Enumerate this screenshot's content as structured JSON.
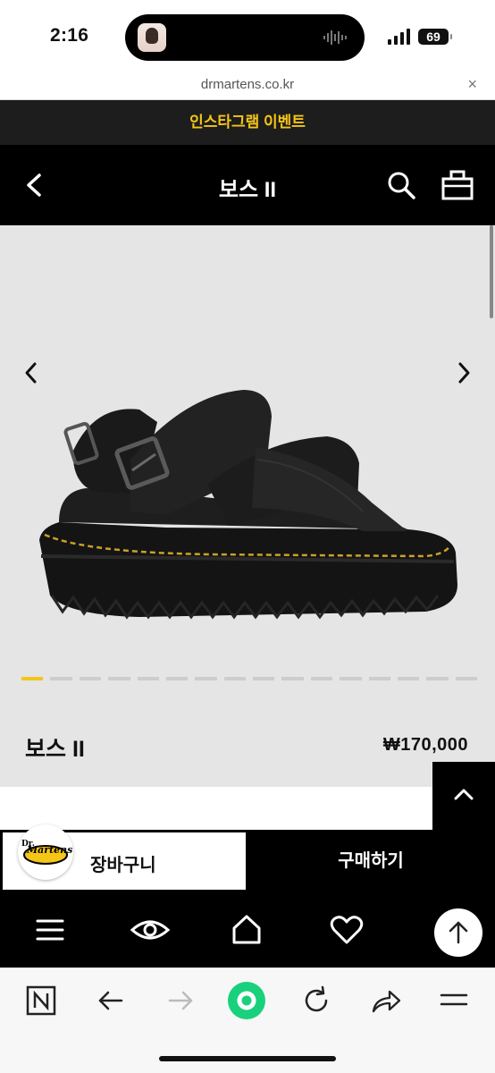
{
  "status_bar": {
    "time": "2:16",
    "battery": "69"
  },
  "browser": {
    "url": "drmartens.co.kr",
    "close_glyph": "×"
  },
  "promo": {
    "text": "인스타그램 이벤트"
  },
  "header": {
    "title": "보스 II"
  },
  "gallery": {
    "slide_count": 16,
    "active_index": 0
  },
  "product": {
    "name": "보스 II",
    "price": "₩170,000"
  },
  "actions": {
    "cart_label": "장바구니",
    "buy_label": "구매하기"
  },
  "logo": {
    "text_line1": "Dr.",
    "text_line2": "Martens"
  },
  "site_nav": {
    "items": [
      "menu-icon",
      "eye-icon",
      "home-icon",
      "heart-icon"
    ]
  },
  "toolbar": {
    "items": [
      "naver-icon",
      "back-icon",
      "forward-icon",
      "green-dot-icon",
      "reload-icon",
      "share-icon",
      "menu-icon"
    ]
  },
  "colors": {
    "accent_yellow": "#f5c518",
    "green": "#19d17d",
    "black": "#000000"
  }
}
